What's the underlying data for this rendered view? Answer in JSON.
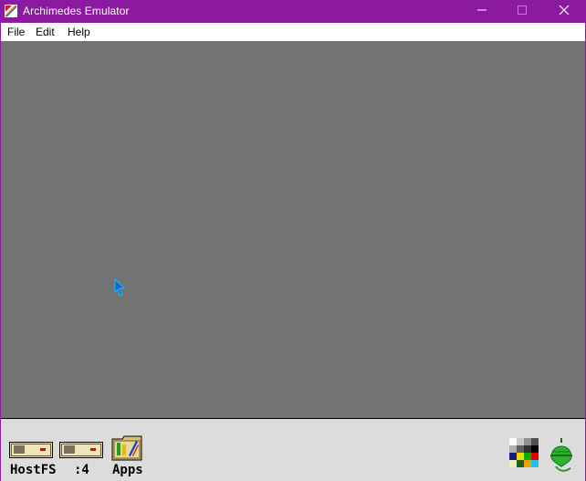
{
  "window": {
    "title": "Archimedes Emulator"
  },
  "menu": [
    {
      "label": "File"
    },
    {
      "label": "Edit"
    },
    {
      "label": "Help"
    }
  ],
  "iconbar": {
    "drives": [
      {
        "label": "HostFS"
      },
      {
        "label": ":4"
      }
    ],
    "apps_label": "Apps"
  },
  "colors": {
    "titlebar": "#8b1aa0",
    "desktop": "#737373",
    "iconbar": "#dcdcdc"
  }
}
